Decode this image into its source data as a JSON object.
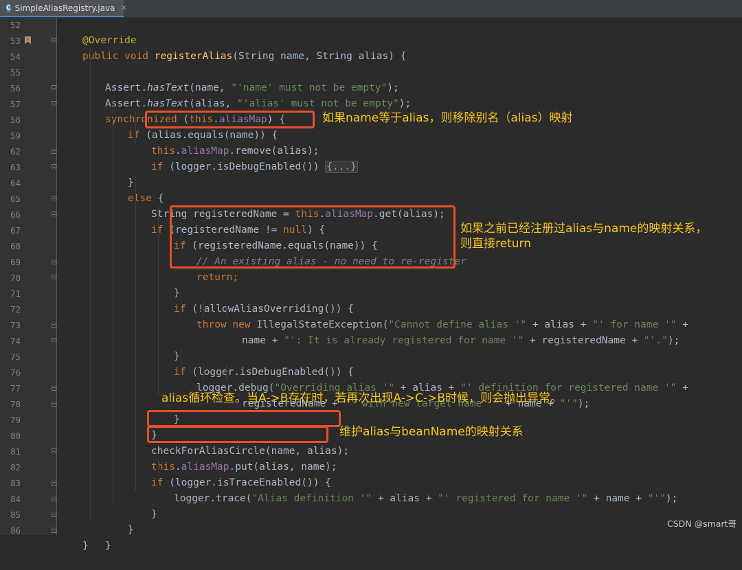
{
  "tab": {
    "file_name": "SimpleAliasRegistry.java",
    "file_icon": "java-class-icon",
    "close_icon": "close-icon"
  },
  "gutter": {
    "line_numbers": [
      "52",
      "53",
      "54",
      "55",
      "56",
      "57",
      "58",
      "59",
      "62",
      "63",
      "64",
      "65",
      "66",
      "67",
      "68",
      "69",
      "70",
      "71",
      "72",
      "73",
      "74",
      "75",
      "76",
      "77",
      "78",
      "79",
      "80",
      "81",
      "82",
      "83",
      "84",
      "85",
      "86"
    ]
  },
  "code": {
    "annotation": "@Override",
    "l53": {
      "modifiers": "public void ",
      "method": "registerAlias",
      "params": "(String name, String alias) {"
    },
    "l54": {
      "cls": "Assert.",
      "call": "hasText",
      "args": "(name, ",
      "str": "\"'name' must not be empty\"",
      "end": ");"
    },
    "l55": {
      "cls": "Assert.",
      "call": "hasText",
      "args": "(alias, ",
      "str": "\"'alias' must not be empty\"",
      "end": ");"
    },
    "l56": {
      "kw": "synchronized ",
      "open": "(",
      "this": "this",
      "dot": ".",
      "field": "aliasMap",
      "end": ") {"
    },
    "l57": {
      "kw": "if ",
      "rest": "(alias.equals(name)) {"
    },
    "l58": {
      "this": "this",
      "dot": ".",
      "field": "aliasMap",
      "rest": ".remove(alias);"
    },
    "l59": {
      "kw": "if ",
      "rest": "(logger.isDebugEnabled()) ",
      "folded": "{...}"
    },
    "l62": "}",
    "l63": {
      "kw": "else",
      "rest": " {"
    },
    "l64": {
      "type": "String registeredName = ",
      "this": "this",
      "dot": ".",
      "field": "aliasMap",
      "rest": ".get(alias);"
    },
    "l65": {
      "kw": "if ",
      "rest": "(registeredName != ",
      "null": "null",
      "end": ") {"
    },
    "l66": {
      "kw": "if ",
      "rest": "(registeredName.equals(name)) {"
    },
    "l67": "// An existing alias - no need to re-register",
    "l68": {
      "kw": "return",
      "end": ";"
    },
    "l69": "}",
    "l70": {
      "kw": "if ",
      "rest": "(!allowAliasOverriding()) {"
    },
    "l71": {
      "kw1": "throw ",
      "kw2": "new ",
      "rest": "IllegalStateException(",
      "s1": "\"Cannot define alias '\"",
      "m1": " + alias + ",
      "s2": "\"' for name '\"",
      "m2": " +"
    },
    "l72": {
      "rest": "name + ",
      "s1": "\"': It is already registered for name '\"",
      "m1": " + registeredName + ",
      "s2": "\"'.\"",
      "end": ");"
    },
    "l73": "}",
    "l74": {
      "kw": "if ",
      "rest": "(logger.isDebugEnabled()) {"
    },
    "l75": {
      "rest": "logger.debug(",
      "s1": "\"Overriding alias '\"",
      "m1": " + alias + ",
      "s2": "\"' definition for registered name '\"",
      "m2": " +"
    },
    "l76": {
      "rest": "registeredName + ",
      "s1": "\"' with new target name '\"",
      "m1": " + name + ",
      "s2": "\"'\"",
      "end": ");"
    },
    "l77": "}",
    "l78": "}",
    "l79": "checkForAliasCircle(name, alias);",
    "l80": {
      "this": "this",
      "dot": ".",
      "field": "aliasMap",
      "rest": ".put(alias, name);"
    },
    "l81": {
      "kw": "if ",
      "rest": "(logger.isTraceEnabled()) {"
    },
    "l82": {
      "rest": "logger.trace(",
      "s1": "\"Alias definition '\"",
      "m1": " + alias + ",
      "s2": "\"' registered for name '\"",
      "m2": " + name + ",
      "s3": "\"'\"",
      "end": ");"
    },
    "l83": "}",
    "l84": "}",
    "l85": "}",
    "l86": "}"
  },
  "annotations": {
    "a1": "如果name等于alias，则移除别名（alias）映射",
    "a2_line1": "如果之前已经注册过alias与name的映射关系，",
    "a2_line2": "则直接return",
    "a3": "alias循环检查。当A->B存在时，若再次出现A->C->B时候，则会抛出异常。",
    "a4": "维护alias与beanName的映射关系"
  },
  "colors": {
    "highlight_box": "#e8502c",
    "annotation_text": "#f5c518"
  },
  "watermark": "CSDN @smart哥"
}
